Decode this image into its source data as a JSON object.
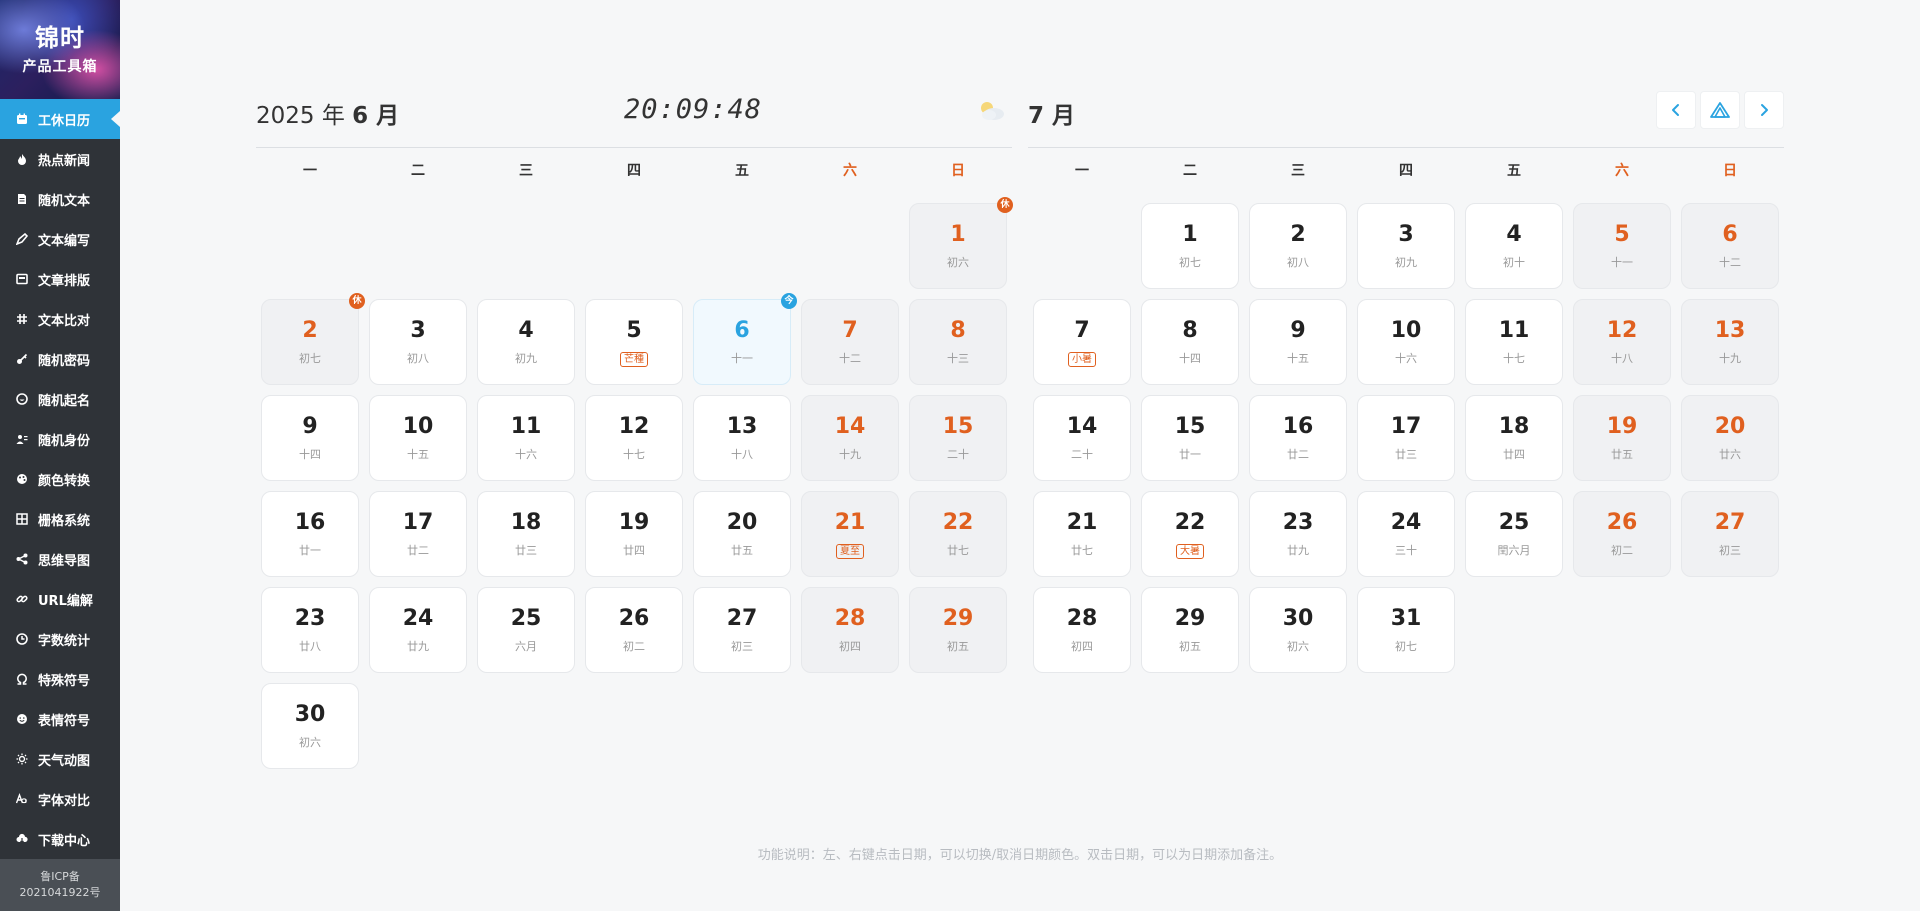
{
  "sidebar": {
    "logo_title": "锦时",
    "logo_sub": "产品工具箱",
    "items": [
      {
        "label": "工休日历",
        "icon": "calendar-icon",
        "active": true
      },
      {
        "label": "热点新闻",
        "icon": "flame-icon"
      },
      {
        "label": "随机文本",
        "icon": "document-icon"
      },
      {
        "label": "文本编写",
        "icon": "pen-icon"
      },
      {
        "label": "文章排版",
        "icon": "layout-icon"
      },
      {
        "label": "文本比对",
        "icon": "hash-icon"
      },
      {
        "label": "随机密码",
        "icon": "key-icon"
      },
      {
        "label": "随机起名",
        "icon": "smile-icon"
      },
      {
        "label": "随机身份",
        "icon": "id-card-icon"
      },
      {
        "label": "颜色转换",
        "icon": "palette-icon"
      },
      {
        "label": "栅格系统",
        "icon": "grid-icon"
      },
      {
        "label": "思维导图",
        "icon": "share-icon"
      },
      {
        "label": "URL编解",
        "icon": "link-icon"
      },
      {
        "label": "字数统计",
        "icon": "clock-icon"
      },
      {
        "label": "特殊符号",
        "icon": "omega-icon"
      },
      {
        "label": "表情符号",
        "icon": "emoji-icon"
      },
      {
        "label": "天气动图",
        "icon": "sun-icon"
      },
      {
        "label": "字体对比",
        "icon": "font-icon"
      },
      {
        "label": "下载中心",
        "icon": "cloud-download-icon"
      }
    ],
    "icp_line1": "鲁ICP备",
    "icp_line2": "2021041922号"
  },
  "header": {
    "left_year": "2025 年 ",
    "left_month": "6 月",
    "clock": "20:09:48",
    "weather_icon": "partly-cloudy-icon",
    "right_month": "7 月",
    "prev_icon": "chevron-left-icon",
    "home_icon": "mountain-icon",
    "next_icon": "chevron-right-icon"
  },
  "weekdays": [
    "一",
    "二",
    "三",
    "四",
    "五",
    "六",
    "日"
  ],
  "june": [
    {
      "empty": true
    },
    {
      "empty": true
    },
    {
      "empty": true
    },
    {
      "empty": true
    },
    {
      "empty": true
    },
    {
      "empty": true
    },
    {
      "day": "1",
      "lunar": "初六",
      "wknd": true,
      "badge": "休"
    },
    {
      "day": "2",
      "lunar": "初七",
      "wknd": true,
      "badge": "休"
    },
    {
      "day": "3",
      "lunar": "初八"
    },
    {
      "day": "4",
      "lunar": "初九"
    },
    {
      "day": "5",
      "lunar": "芒種",
      "term": true
    },
    {
      "day": "6",
      "lunar": "十一",
      "today": true,
      "badge": "今"
    },
    {
      "day": "7",
      "lunar": "十二",
      "wknd": true
    },
    {
      "day": "8",
      "lunar": "十三",
      "wknd": true
    },
    {
      "day": "9",
      "lunar": "十四"
    },
    {
      "day": "10",
      "lunar": "十五"
    },
    {
      "day": "11",
      "lunar": "十六"
    },
    {
      "day": "12",
      "lunar": "十七"
    },
    {
      "day": "13",
      "lunar": "十八"
    },
    {
      "day": "14",
      "lunar": "十九",
      "wknd": true
    },
    {
      "day": "15",
      "lunar": "二十",
      "wknd": true
    },
    {
      "day": "16",
      "lunar": "廿一"
    },
    {
      "day": "17",
      "lunar": "廿二"
    },
    {
      "day": "18",
      "lunar": "廿三"
    },
    {
      "day": "19",
      "lunar": "廿四"
    },
    {
      "day": "20",
      "lunar": "廿五"
    },
    {
      "day": "21",
      "lunar": "夏至",
      "wknd": true,
      "term": true
    },
    {
      "day": "22",
      "lunar": "廿七",
      "wknd": true
    },
    {
      "day": "23",
      "lunar": "廿八"
    },
    {
      "day": "24",
      "lunar": "廿九"
    },
    {
      "day": "25",
      "lunar": "六月"
    },
    {
      "day": "26",
      "lunar": "初二"
    },
    {
      "day": "27",
      "lunar": "初三"
    },
    {
      "day": "28",
      "lunar": "初四",
      "wknd": true
    },
    {
      "day": "29",
      "lunar": "初五",
      "wknd": true
    },
    {
      "day": "30",
      "lunar": "初六"
    }
  ],
  "july": [
    {
      "empty": true
    },
    {
      "day": "1",
      "lunar": "初七"
    },
    {
      "day": "2",
      "lunar": "初八"
    },
    {
      "day": "3",
      "lunar": "初九"
    },
    {
      "day": "4",
      "lunar": "初十"
    },
    {
      "day": "5",
      "lunar": "十一",
      "wknd": true
    },
    {
      "day": "6",
      "lunar": "十二",
      "wknd": true
    },
    {
      "day": "7",
      "lunar": "小暑",
      "term": true
    },
    {
      "day": "8",
      "lunar": "十四"
    },
    {
      "day": "9",
      "lunar": "十五"
    },
    {
      "day": "10",
      "lunar": "十六"
    },
    {
      "day": "11",
      "lunar": "十七"
    },
    {
      "day": "12",
      "lunar": "十八",
      "wknd": true
    },
    {
      "day": "13",
      "lunar": "十九",
      "wknd": true
    },
    {
      "day": "14",
      "lunar": "二十"
    },
    {
      "day": "15",
      "lunar": "廿一"
    },
    {
      "day": "16",
      "lunar": "廿二"
    },
    {
      "day": "17",
      "lunar": "廿三"
    },
    {
      "day": "18",
      "lunar": "廿四"
    },
    {
      "day": "19",
      "lunar": "廿五",
      "wknd": true
    },
    {
      "day": "20",
      "lunar": "廿六",
      "wknd": true
    },
    {
      "day": "21",
      "lunar": "廿七"
    },
    {
      "day": "22",
      "lunar": "大暑",
      "term": true
    },
    {
      "day": "23",
      "lunar": "廿九"
    },
    {
      "day": "24",
      "lunar": "三十"
    },
    {
      "day": "25",
      "lunar": "閏六月"
    },
    {
      "day": "26",
      "lunar": "初二",
      "wknd": true
    },
    {
      "day": "27",
      "lunar": "初三",
      "wknd": true
    },
    {
      "day": "28",
      "lunar": "初四"
    },
    {
      "day": "29",
      "lunar": "初五"
    },
    {
      "day": "30",
      "lunar": "初六"
    },
    {
      "day": "31",
      "lunar": "初七"
    }
  ],
  "footer_note": "功能说明：左、右键点击日期，可以切换/取消日期颜色。双击日期，可以为日期添加备注。",
  "colors": {
    "accent": "#2aa3e0",
    "weekend": "#e0601f",
    "sidebar_bg": "#2f3338"
  }
}
